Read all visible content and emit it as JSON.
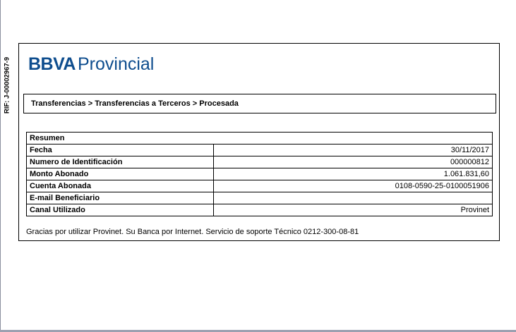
{
  "rif": "RIF: J-00002967-9",
  "brand": {
    "name_bold": "BBVA",
    "name_light": "Provincial",
    "color": "#0e4d8e"
  },
  "breadcrumb": "Transferencias > Transferencias a Terceros > Procesada",
  "summary": {
    "title": "Resumen",
    "rows": [
      {
        "label": "Fecha",
        "value": "30/11/2017"
      },
      {
        "label": "Numero de Identificación",
        "value": "000000812"
      },
      {
        "label": "Monto Abonado",
        "value": "1.061.831,60"
      },
      {
        "label": "Cuenta Abonada",
        "value": "0108-0590-25-0100051906"
      },
      {
        "label": "E-mail Beneficiario",
        "value": ""
      },
      {
        "label": "Canal Utilizado",
        "value": "Provinet"
      }
    ]
  },
  "footer": "Gracias por utilizar Provinet. Su Banca por Internet. Servicio de soporte Técnico 0212-300-08-81"
}
